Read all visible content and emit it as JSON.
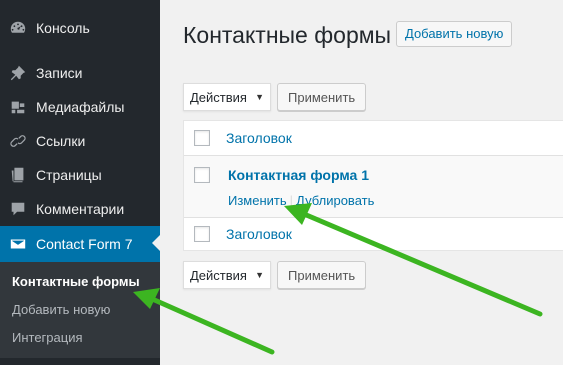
{
  "sidebar": {
    "items": [
      {
        "label": "Консоль",
        "icon": "dashboard-icon"
      },
      {
        "label": "Записи",
        "icon": "pin-icon"
      },
      {
        "label": "Медиафайлы",
        "icon": "media-icon"
      },
      {
        "label": "Ссылки",
        "icon": "link-icon"
      },
      {
        "label": "Страницы",
        "icon": "pages-icon"
      },
      {
        "label": "Комментарии",
        "icon": "comment-icon"
      },
      {
        "label": "Contact Form 7",
        "icon": "mail-icon"
      }
    ],
    "submenu": [
      {
        "label": "Контактные формы"
      },
      {
        "label": "Добавить новую"
      },
      {
        "label": "Интеграция"
      }
    ]
  },
  "header": {
    "title": "Контактные формы",
    "add_new_label": "Добавить новую"
  },
  "bulk_top": {
    "select_value": "Действия",
    "apply_label": "Применить"
  },
  "bulk_bottom": {
    "select_value": "Действия",
    "apply_label": "Применить"
  },
  "table": {
    "header_label": "Заголовок",
    "footer_label": "Заголовок",
    "rows": [
      {
        "title": "Контактная форма 1",
        "actions": {
          "edit": "Изменить",
          "duplicate": "Дублировать"
        }
      }
    ]
  },
  "colors": {
    "sidebar_bg": "#23282d",
    "accent": "#0073aa",
    "arrow": "#3cb521"
  }
}
